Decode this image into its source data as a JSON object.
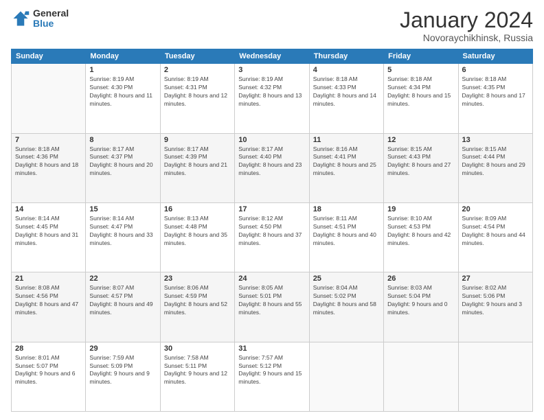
{
  "logo": {
    "general": "General",
    "blue": "Blue"
  },
  "title": "January 2024",
  "location": "Novoraychikhinsk, Russia",
  "days_header": [
    "Sunday",
    "Monday",
    "Tuesday",
    "Wednesday",
    "Thursday",
    "Friday",
    "Saturday"
  ],
  "weeks": [
    [
      {
        "day": "",
        "sunrise": "",
        "sunset": "",
        "daylight": ""
      },
      {
        "day": "1",
        "sunrise": "Sunrise: 8:19 AM",
        "sunset": "Sunset: 4:30 PM",
        "daylight": "Daylight: 8 hours and 11 minutes."
      },
      {
        "day": "2",
        "sunrise": "Sunrise: 8:19 AM",
        "sunset": "Sunset: 4:31 PM",
        "daylight": "Daylight: 8 hours and 12 minutes."
      },
      {
        "day": "3",
        "sunrise": "Sunrise: 8:19 AM",
        "sunset": "Sunset: 4:32 PM",
        "daylight": "Daylight: 8 hours and 13 minutes."
      },
      {
        "day": "4",
        "sunrise": "Sunrise: 8:18 AM",
        "sunset": "Sunset: 4:33 PM",
        "daylight": "Daylight: 8 hours and 14 minutes."
      },
      {
        "day": "5",
        "sunrise": "Sunrise: 8:18 AM",
        "sunset": "Sunset: 4:34 PM",
        "daylight": "Daylight: 8 hours and 15 minutes."
      },
      {
        "day": "6",
        "sunrise": "Sunrise: 8:18 AM",
        "sunset": "Sunset: 4:35 PM",
        "daylight": "Daylight: 8 hours and 17 minutes."
      }
    ],
    [
      {
        "day": "7",
        "sunrise": "Sunrise: 8:18 AM",
        "sunset": "Sunset: 4:36 PM",
        "daylight": "Daylight: 8 hours and 18 minutes."
      },
      {
        "day": "8",
        "sunrise": "Sunrise: 8:17 AM",
        "sunset": "Sunset: 4:37 PM",
        "daylight": "Daylight: 8 hours and 20 minutes."
      },
      {
        "day": "9",
        "sunrise": "Sunrise: 8:17 AM",
        "sunset": "Sunset: 4:39 PM",
        "daylight": "Daylight: 8 hours and 21 minutes."
      },
      {
        "day": "10",
        "sunrise": "Sunrise: 8:17 AM",
        "sunset": "Sunset: 4:40 PM",
        "daylight": "Daylight: 8 hours and 23 minutes."
      },
      {
        "day": "11",
        "sunrise": "Sunrise: 8:16 AM",
        "sunset": "Sunset: 4:41 PM",
        "daylight": "Daylight: 8 hours and 25 minutes."
      },
      {
        "day": "12",
        "sunrise": "Sunrise: 8:15 AM",
        "sunset": "Sunset: 4:43 PM",
        "daylight": "Daylight: 8 hours and 27 minutes."
      },
      {
        "day": "13",
        "sunrise": "Sunrise: 8:15 AM",
        "sunset": "Sunset: 4:44 PM",
        "daylight": "Daylight: 8 hours and 29 minutes."
      }
    ],
    [
      {
        "day": "14",
        "sunrise": "Sunrise: 8:14 AM",
        "sunset": "Sunset: 4:45 PM",
        "daylight": "Daylight: 8 hours and 31 minutes."
      },
      {
        "day": "15",
        "sunrise": "Sunrise: 8:14 AM",
        "sunset": "Sunset: 4:47 PM",
        "daylight": "Daylight: 8 hours and 33 minutes."
      },
      {
        "day": "16",
        "sunrise": "Sunrise: 8:13 AM",
        "sunset": "Sunset: 4:48 PM",
        "daylight": "Daylight: 8 hours and 35 minutes."
      },
      {
        "day": "17",
        "sunrise": "Sunrise: 8:12 AM",
        "sunset": "Sunset: 4:50 PM",
        "daylight": "Daylight: 8 hours and 37 minutes."
      },
      {
        "day": "18",
        "sunrise": "Sunrise: 8:11 AM",
        "sunset": "Sunset: 4:51 PM",
        "daylight": "Daylight: 8 hours and 40 minutes."
      },
      {
        "day": "19",
        "sunrise": "Sunrise: 8:10 AM",
        "sunset": "Sunset: 4:53 PM",
        "daylight": "Daylight: 8 hours and 42 minutes."
      },
      {
        "day": "20",
        "sunrise": "Sunrise: 8:09 AM",
        "sunset": "Sunset: 4:54 PM",
        "daylight": "Daylight: 8 hours and 44 minutes."
      }
    ],
    [
      {
        "day": "21",
        "sunrise": "Sunrise: 8:08 AM",
        "sunset": "Sunset: 4:56 PM",
        "daylight": "Daylight: 8 hours and 47 minutes."
      },
      {
        "day": "22",
        "sunrise": "Sunrise: 8:07 AM",
        "sunset": "Sunset: 4:57 PM",
        "daylight": "Daylight: 8 hours and 49 minutes."
      },
      {
        "day": "23",
        "sunrise": "Sunrise: 8:06 AM",
        "sunset": "Sunset: 4:59 PM",
        "daylight": "Daylight: 8 hours and 52 minutes."
      },
      {
        "day": "24",
        "sunrise": "Sunrise: 8:05 AM",
        "sunset": "Sunset: 5:01 PM",
        "daylight": "Daylight: 8 hours and 55 minutes."
      },
      {
        "day": "25",
        "sunrise": "Sunrise: 8:04 AM",
        "sunset": "Sunset: 5:02 PM",
        "daylight": "Daylight: 8 hours and 58 minutes."
      },
      {
        "day": "26",
        "sunrise": "Sunrise: 8:03 AM",
        "sunset": "Sunset: 5:04 PM",
        "daylight": "Daylight: 9 hours and 0 minutes."
      },
      {
        "day": "27",
        "sunrise": "Sunrise: 8:02 AM",
        "sunset": "Sunset: 5:06 PM",
        "daylight": "Daylight: 9 hours and 3 minutes."
      }
    ],
    [
      {
        "day": "28",
        "sunrise": "Sunrise: 8:01 AM",
        "sunset": "Sunset: 5:07 PM",
        "daylight": "Daylight: 9 hours and 6 minutes."
      },
      {
        "day": "29",
        "sunrise": "Sunrise: 7:59 AM",
        "sunset": "Sunset: 5:09 PM",
        "daylight": "Daylight: 9 hours and 9 minutes."
      },
      {
        "day": "30",
        "sunrise": "Sunrise: 7:58 AM",
        "sunset": "Sunset: 5:11 PM",
        "daylight": "Daylight: 9 hours and 12 minutes."
      },
      {
        "day": "31",
        "sunrise": "Sunrise: 7:57 AM",
        "sunset": "Sunset: 5:12 PM",
        "daylight": "Daylight: 9 hours and 15 minutes."
      },
      {
        "day": "",
        "sunrise": "",
        "sunset": "",
        "daylight": ""
      },
      {
        "day": "",
        "sunrise": "",
        "sunset": "",
        "daylight": ""
      },
      {
        "day": "",
        "sunrise": "",
        "sunset": "",
        "daylight": ""
      }
    ]
  ]
}
